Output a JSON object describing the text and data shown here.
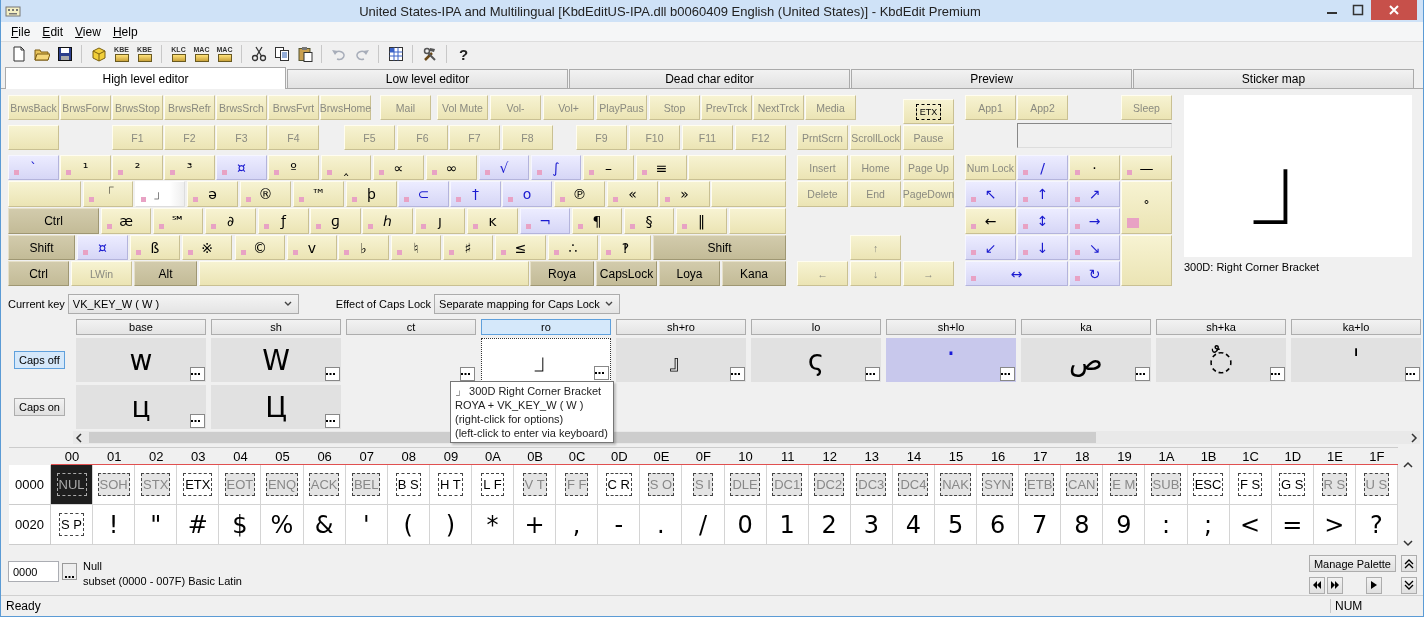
{
  "window": {
    "title": "United States-IPA and Multilingual [KbdEditUS-IPA.dll b0060409 English (United States)] - KbdEdit Premium"
  },
  "menu": [
    "File",
    "Edit",
    "View",
    "Help"
  ],
  "toolbar": {
    "groups": [
      [
        {
          "kind": "new",
          "disabled": false
        },
        {
          "kind": "open",
          "disabled": false
        },
        {
          "kind": "save",
          "disabled": false
        }
      ],
      [
        {
          "kind": "package",
          "disabled": false
        },
        {
          "kind": "labeled",
          "label": "KBE",
          "disabled": false
        },
        {
          "kind": "labeled",
          "label": "KBE",
          "disabled": false
        }
      ],
      [
        {
          "kind": "labeled",
          "label": "KLC",
          "disabled": false
        },
        {
          "kind": "labeled",
          "label": "MAC",
          "disabled": false
        },
        {
          "kind": "labeled",
          "label": "MAC",
          "disabled": false
        }
      ],
      [
        {
          "kind": "cut",
          "disabled": false
        },
        {
          "kind": "copy",
          "disabled": false
        },
        {
          "kind": "paste",
          "disabled": false
        }
      ],
      [
        {
          "kind": "undo",
          "disabled": true
        },
        {
          "kind": "redo",
          "disabled": true
        }
      ],
      [
        {
          "kind": "charmap",
          "disabled": false
        }
      ],
      [
        {
          "kind": "tools",
          "disabled": false
        }
      ],
      [
        {
          "kind": "glyph",
          "label": "?",
          "disabled": false
        }
      ]
    ]
  },
  "tabs": [
    {
      "label": "High level editor",
      "selected": true
    },
    {
      "label": "Low level editor",
      "selected": false
    },
    {
      "label": "Dead char editor",
      "selected": false
    },
    {
      "label": "Preview",
      "selected": false
    },
    {
      "label": "Sticker map",
      "selected": false
    }
  ],
  "keyboard": {
    "main_rows": [
      [
        {
          "label": "BrwsBack",
          "kind": "func",
          "selected": false
        },
        {
          "label": "BrwsForw",
          "kind": "func",
          "selected": false
        },
        {
          "label": "BrwsStop",
          "kind": "func",
          "selected": false
        },
        {
          "label": "BrwsRefr",
          "kind": "func",
          "selected": false
        },
        {
          "label": "BrwsSrch",
          "kind": "func",
          "selected": false
        },
        {
          "label": "BrwsFvrt",
          "kind": "func",
          "selected": false
        },
        {
          "label": "BrwsHome",
          "kind": "func",
          "selected": false
        },
        {
          "label": "Mail",
          "kind": "func",
          "selected": false
        },
        {
          "label": "Vol Mute",
          "kind": "func",
          "selected": false
        },
        {
          "label": "Vol-",
          "kind": "func",
          "selected": false
        },
        {
          "label": "Vol+",
          "kind": "func",
          "selected": false
        },
        {
          "label": "PlayPaus",
          "kind": "func",
          "selected": false
        },
        {
          "label": "Stop",
          "kind": "func",
          "selected": false
        },
        {
          "label": "PrevTrck",
          "kind": "func",
          "selected": false
        },
        {
          "label": "NextTrck",
          "kind": "func",
          "selected": false
        },
        {
          "label": "Media",
          "kind": "func",
          "selected": false
        }
      ],
      [
        {
          "kind": "func",
          "selected": false
        },
        {
          "label": "F1",
          "kind": "func",
          "selected": false
        },
        {
          "label": "F2",
          "kind": "func",
          "selected": false
        },
        {
          "label": "F3",
          "kind": "func",
          "selected": false
        },
        {
          "label": "F4",
          "kind": "func",
          "selected": false
        },
        {
          "label": "F5",
          "kind": "func",
          "selected": false
        },
        {
          "label": "F6",
          "kind": "func",
          "selected": false
        },
        {
          "label": "F7",
          "kind": "func",
          "selected": false
        },
        {
          "label": "F8",
          "kind": "func",
          "selected": false
        },
        {
          "label": "F9",
          "kind": "func",
          "selected": false
        },
        {
          "label": "F10",
          "kind": "func",
          "selected": false
        },
        {
          "label": "F11",
          "kind": "func",
          "selected": false
        },
        {
          "label": "F12",
          "kind": "func",
          "selected": false
        }
      ],
      [
        {
          "label": "`",
          "kind": "dead",
          "selected": false
        },
        {
          "label": "¹",
          "kind": "char",
          "selected": false
        },
        {
          "label": "²",
          "kind": "char",
          "selected": false
        },
        {
          "label": "³",
          "kind": "char",
          "selected": false
        },
        {
          "label": "¤",
          "kind": "dead",
          "selected": false
        },
        {
          "label": "º",
          "kind": "char",
          "selected": false
        },
        {
          "label": "‸",
          "kind": "char",
          "selected": false
        },
        {
          "label": "∝",
          "kind": "char",
          "selected": false
        },
        {
          "label": "∞",
          "kind": "char",
          "selected": false
        },
        {
          "label": "√",
          "kind": "dead",
          "selected": false
        },
        {
          "label": "∫",
          "kind": "dead",
          "selected": false
        },
        {
          "label": "–",
          "kind": "char",
          "selected": false
        },
        {
          "label": "≡",
          "kind": "char",
          "selected": false
        },
        {
          "kind": "func",
          "selected": false
        }
      ],
      [
        {
          "kind": "func",
          "selected": false
        },
        {
          "label": "「",
          "kind": "char",
          "selected": false
        },
        {
          "label": "」",
          "kind": "char",
          "selected": true
        },
        {
          "label": "ə",
          "kind": "char",
          "selected": false
        },
        {
          "label": "®",
          "kind": "char",
          "selected": false
        },
        {
          "label": "™",
          "kind": "char",
          "selected": false
        },
        {
          "label": "þ",
          "kind": "char",
          "selected": false
        },
        {
          "label": "⊂",
          "kind": "dead",
          "selected": false
        },
        {
          "label": "†",
          "kind": "dead",
          "selected": false
        },
        {
          "label": "o",
          "kind": "dead",
          "selected": false
        },
        {
          "label": "℗",
          "kind": "char",
          "selected": false
        },
        {
          "label": "«",
          "kind": "char",
          "selected": false
        },
        {
          "label": "»",
          "kind": "char",
          "selected": false
        },
        {
          "kind": "func",
          "selected": false
        }
      ],
      [
        {
          "label": "Ctrl",
          "kind": "mod",
          "selected": false
        },
        {
          "label": "æ",
          "kind": "char",
          "selected": false
        },
        {
          "label": "℠",
          "kind": "char",
          "selected": false
        },
        {
          "label": "∂",
          "kind": "char",
          "selected": false
        },
        {
          "label": "ƒ",
          "kind": "char",
          "selected": false
        },
        {
          "label": "ɡ",
          "kind": "char",
          "selected": false
        },
        {
          "label": "ℎ",
          "kind": "char",
          "selected": false
        },
        {
          "label": "ȷ",
          "kind": "char",
          "selected": false
        },
        {
          "label": "ĸ",
          "kind": "char",
          "selected": false
        },
        {
          "label": "¬",
          "kind": "dead",
          "selected": false
        },
        {
          "label": "¶",
          "kind": "char",
          "selected": false
        },
        {
          "label": "§",
          "kind": "char",
          "selected": false
        },
        {
          "label": "‖",
          "kind": "char",
          "selected": false
        },
        {
          "kind": "func",
          "selected": false
        }
      ],
      [
        {
          "label": "Shift",
          "kind": "mod",
          "selected": false
        },
        {
          "label": "¤",
          "kind": "dead",
          "selected": false
        },
        {
          "label": "ß",
          "kind": "char",
          "selected": false
        },
        {
          "label": "※",
          "kind": "char",
          "selected": false
        },
        {
          "label": "©",
          "kind": "char",
          "selected": false
        },
        {
          "label": "v",
          "kind": "char",
          "selected": false
        },
        {
          "label": "♭",
          "kind": "char",
          "selected": false
        },
        {
          "label": "♮",
          "kind": "char",
          "selected": false
        },
        {
          "label": "♯",
          "kind": "char",
          "selected": false
        },
        {
          "label": "≤",
          "kind": "char",
          "selected": false
        },
        {
          "label": "∴",
          "kind": "char",
          "selected": false
        },
        {
          "label": "‽",
          "kind": "char",
          "selected": false
        },
        {
          "label": "Shift",
          "kind": "mod",
          "selected": false
        }
      ],
      [
        {
          "label": "Ctrl",
          "kind": "mod",
          "selected": false
        },
        {
          "label": "LWin",
          "kind": "func",
          "selected": false
        },
        {
          "label": "Alt",
          "kind": "mod",
          "selected": false
        },
        {
          "kind": "func",
          "selected": false
        },
        {
          "label": "Roya",
          "kind": "mod",
          "selected": false
        },
        {
          "label": "CapsLock",
          "kind": "mod",
          "selected": false
        },
        {
          "label": "Loya",
          "kind": "mod",
          "selected": false
        },
        {
          "label": "Kana",
          "kind": "mod",
          "selected": false
        }
      ]
    ],
    "nav_keys": [
      {
        "label": "ETX",
        "kind": "control",
        "selected": false
      },
      {
        "label": "PrntScrn",
        "kind": "func",
        "selected": false
      },
      {
        "label": "ScrollLock",
        "kind": "func",
        "selected": false
      },
      {
        "label": "Pause",
        "kind": "func",
        "selected": false
      },
      {
        "label": "Insert",
        "kind": "func",
        "selected": false
      },
      {
        "label": "Home",
        "kind": "func",
        "selected": false
      },
      {
        "label": "Page Up",
        "kind": "func",
        "selected": false
      },
      {
        "label": "Delete",
        "kind": "func",
        "selected": false
      },
      {
        "label": "End",
        "kind": "func",
        "selected": false
      },
      {
        "label": "PageDown",
        "kind": "func",
        "selected": false
      },
      {
        "label": "↑",
        "kind": "func",
        "selected": false
      },
      {
        "label": "←",
        "kind": "func",
        "selected": false
      },
      {
        "label": "↓",
        "kind": "func",
        "selected": false
      },
      {
        "label": "→",
        "kind": "func",
        "selected": false
      }
    ],
    "numpad_keys": [
      {
        "label": "App1",
        "kind": "func",
        "selected": false
      },
      {
        "label": "App2",
        "kind": "func",
        "selected": false
      },
      {
        "label": "Sleep",
        "kind": "func",
        "selected": false
      },
      {
        "label": "Num Lock",
        "kind": "func",
        "selected": false
      },
      {
        "label": "/",
        "kind": "dead",
        "selected": false
      },
      {
        "label": "·",
        "kind": "char",
        "selected": false
      },
      {
        "label": "—",
        "kind": "char",
        "selected": false
      },
      {
        "label": "↖",
        "kind": "dead",
        "selected": false
      },
      {
        "label": "↑",
        "kind": "dead",
        "selected": false
      },
      {
        "label": "↗",
        "kind": "dead",
        "selected": false
      },
      {
        "label": "˚",
        "kind": "marked",
        "selected": false
      },
      {
        "label": "←",
        "kind": "char",
        "selected": false
      },
      {
        "label": "↕",
        "kind": "dead",
        "selected": false
      },
      {
        "label": "→",
        "kind": "dead",
        "selected": false
      },
      {
        "label": "↙",
        "kind": "dead",
        "selected": false
      },
      {
        "label": "↓",
        "kind": "dead",
        "selected": false
      },
      {
        "label": "↘",
        "kind": "dead",
        "selected": false
      },
      {
        "kind": "func",
        "selected": false
      },
      {
        "label": "↔",
        "kind": "dead",
        "selected": false
      },
      {
        "label": "↻",
        "kind": "dead",
        "selected": false
      }
    ],
    "preview": {
      "glyph": "」",
      "caption": "300D: Right Corner Bracket"
    }
  },
  "current_key": {
    "label": "Current key",
    "value": "VK_KEY_W ( W )"
  },
  "caps_lock_effect": {
    "label": "Effect of Caps Lock",
    "value": "Separate mapping for Caps Lock"
  },
  "mapping": {
    "columns": [
      {
        "label": "base",
        "selected": false
      },
      {
        "label": "sh",
        "selected": false
      },
      {
        "label": "ct",
        "selected": false
      },
      {
        "label": "ro",
        "selected": true
      },
      {
        "label": "sh+ro",
        "selected": false
      },
      {
        "label": "lo",
        "selected": false
      },
      {
        "label": "sh+lo",
        "selected": false
      },
      {
        "label": "ka",
        "selected": false
      },
      {
        "label": "sh+ka",
        "selected": false
      },
      {
        "label": "ka+lo",
        "selected": false
      }
    ],
    "rows": [
      {
        "label": "Caps off",
        "selected": true,
        "cells": [
          {
            "glyph": "w",
            "kind": "normal"
          },
          {
            "glyph": "W",
            "kind": "normal"
          },
          {
            "kind": "empty"
          },
          {
            "glyph": "」",
            "kind": "focused"
          },
          {
            "glyph": "』",
            "kind": "normal"
          },
          {
            "glyph": "ς",
            "kind": "normal"
          },
          {
            "glyph": "‧",
            "kind": "dead"
          },
          {
            "glyph": "ص",
            "kind": "normal"
          },
          {
            "glyph": "◌ٌ",
            "kind": "normal"
          },
          {
            "glyph": "ˈ",
            "kind": "normal"
          }
        ]
      },
      {
        "label": "Caps on",
        "selected": false,
        "cells": [
          {
            "glyph": "ц",
            "kind": "normal"
          },
          {
            "glyph": "Ц",
            "kind": "normal"
          }
        ]
      }
    ],
    "tooltip": [
      "」 300D Right Corner Bracket",
      "ROYA + VK_KEY_W ( W )",
      "(right-click for options)",
      "(left-click to enter via keyboard)"
    ]
  },
  "char_grid": {
    "columns": [
      "00",
      "01",
      "02",
      "03",
      "04",
      "05",
      "06",
      "07",
      "08",
      "09",
      "0A",
      "0B",
      "0C",
      "0D",
      "0E",
      "0F",
      "10",
      "11",
      "12",
      "13",
      "14",
      "15",
      "16",
      "17",
      "18",
      "19",
      "1A",
      "1B",
      "1C",
      "1D",
      "1E",
      "1F"
    ],
    "rows": [
      {
        "label": "0000",
        "cells": [
          {
            "text": "NUL",
            "kind": "control",
            "mapped": false,
            "selected": true
          },
          {
            "text": "SOH",
            "kind": "control",
            "mapped": false,
            "selected": false
          },
          {
            "text": "STX",
            "kind": "control",
            "mapped": false,
            "selected": false
          },
          {
            "text": "ETX",
            "kind": "control",
            "mapped": true,
            "selected": false
          },
          {
            "text": "EOT",
            "kind": "control",
            "mapped": false,
            "selected": false
          },
          {
            "text": "ENQ",
            "kind": "control",
            "mapped": false,
            "selected": false
          },
          {
            "text": "ACK",
            "kind": "control",
            "mapped": false,
            "selected": false
          },
          {
            "text": "BEL",
            "kind": "control",
            "mapped": false,
            "selected": false
          },
          {
            "text": "B S",
            "kind": "control",
            "mapped": true,
            "selected": false
          },
          {
            "text": "H T",
            "kind": "control",
            "mapped": true,
            "selected": false
          },
          {
            "text": "L F",
            "kind": "control",
            "mapped": true,
            "selected": false
          },
          {
            "text": "V T",
            "kind": "control",
            "mapped": false,
            "selected": false
          },
          {
            "text": "F F",
            "kind": "control",
            "mapped": false,
            "selected": false
          },
          {
            "text": "C R",
            "kind": "control",
            "mapped": true,
            "selected": false
          },
          {
            "text": "S O",
            "kind": "control",
            "mapped": false,
            "selected": false
          },
          {
            "text": "S I",
            "kind": "control",
            "mapped": false,
            "selected": false
          },
          {
            "text": "DLE",
            "kind": "control",
            "mapped": false,
            "selected": false
          },
          {
            "text": "DC1",
            "kind": "control",
            "mapped": false,
            "selected": false
          },
          {
            "text": "DC2",
            "kind": "control",
            "mapped": false,
            "selected": false
          },
          {
            "text": "DC3",
            "kind": "control",
            "mapped": false,
            "selected": false
          },
          {
            "text": "DC4",
            "kind": "control",
            "mapped": false,
            "selected": false
          },
          {
            "text": "NAK",
            "kind": "control",
            "mapped": false,
            "selected": false
          },
          {
            "text": "SYN",
            "kind": "control",
            "mapped": false,
            "selected": false
          },
          {
            "text": "ETB",
            "kind": "control",
            "mapped": false,
            "selected": false
          },
          {
            "text": "CAN",
            "kind": "control",
            "mapped": false,
            "selected": false
          },
          {
            "text": "E M",
            "kind": "control",
            "mapped": false,
            "selected": false
          },
          {
            "text": "SUB",
            "kind": "control",
            "mapped": false,
            "selected": false
          },
          {
            "text": "ESC",
            "kind": "control",
            "mapped": true,
            "selected": false
          },
          {
            "text": "F S",
            "kind": "control",
            "mapped": true,
            "selected": false
          },
          {
            "text": "G S",
            "kind": "control",
            "mapped": true,
            "selected": false
          },
          {
            "text": "R S",
            "kind": "control",
            "mapped": false,
            "selected": false
          },
          {
            "text": "U S",
            "kind": "control",
            "mapped": false,
            "selected": false
          }
        ]
      },
      {
        "label": "0020",
        "cells": [
          {
            "text": "S P",
            "kind": "control",
            "mapped": true,
            "selected": false
          },
          {
            "text": "!",
            "kind": "char",
            "selected": false
          },
          {
            "text": "\"",
            "kind": "char",
            "selected": false
          },
          {
            "text": "#",
            "kind": "char",
            "selected": false
          },
          {
            "text": "$",
            "kind": "char",
            "selected": false
          },
          {
            "text": "%",
            "kind": "char",
            "selected": false
          },
          {
            "text": "&",
            "kind": "char",
            "selected": false
          },
          {
            "text": "'",
            "kind": "char",
            "selected": false
          },
          {
            "text": "(",
            "kind": "char",
            "selected": false
          },
          {
            "text": ")",
            "kind": "char",
            "selected": false
          },
          {
            "text": "*",
            "kind": "char",
            "selected": false
          },
          {
            "text": "+",
            "kind": "char",
            "selected": false
          },
          {
            "text": ",",
            "kind": "char",
            "selected": false
          },
          {
            "text": "-",
            "kind": "char",
            "selected": false
          },
          {
            "text": ".",
            "kind": "char",
            "selected": false
          },
          {
            "text": "/",
            "kind": "char",
            "selected": false
          },
          {
            "text": "0",
            "kind": "char",
            "selected": false
          },
          {
            "text": "1",
            "kind": "char",
            "selected": false
          },
          {
            "text": "2",
            "kind": "char",
            "selected": false
          },
          {
            "text": "3",
            "kind": "char",
            "selected": false
          },
          {
            "text": "4",
            "kind": "char",
            "selected": false
          },
          {
            "text": "5",
            "kind": "char",
            "selected": false
          },
          {
            "text": "6",
            "kind": "char",
            "selected": false
          },
          {
            "text": "7",
            "kind": "char",
            "selected": false
          },
          {
            "text": "8",
            "kind": "char",
            "selected": false
          },
          {
            "text": "9",
            "kind": "char",
            "selected": false
          },
          {
            "text": ":",
            "kind": "char",
            "selected": false
          },
          {
            "text": ";",
            "kind": "char",
            "selected": false
          },
          {
            "text": "<",
            "kind": "char",
            "selected": false
          },
          {
            "text": "=",
            "kind": "char",
            "selected": false
          },
          {
            "text": ">",
            "kind": "char",
            "selected": false
          },
          {
            "text": "?",
            "kind": "char",
            "selected": false
          }
        ]
      }
    ]
  },
  "code_field": {
    "value": "0000",
    "name": "Null",
    "subset": "subset (0000 - 007F) Basic Latin"
  },
  "palette_button": "Manage Palette",
  "status_bar": {
    "message": "Ready",
    "num": "NUM"
  }
}
